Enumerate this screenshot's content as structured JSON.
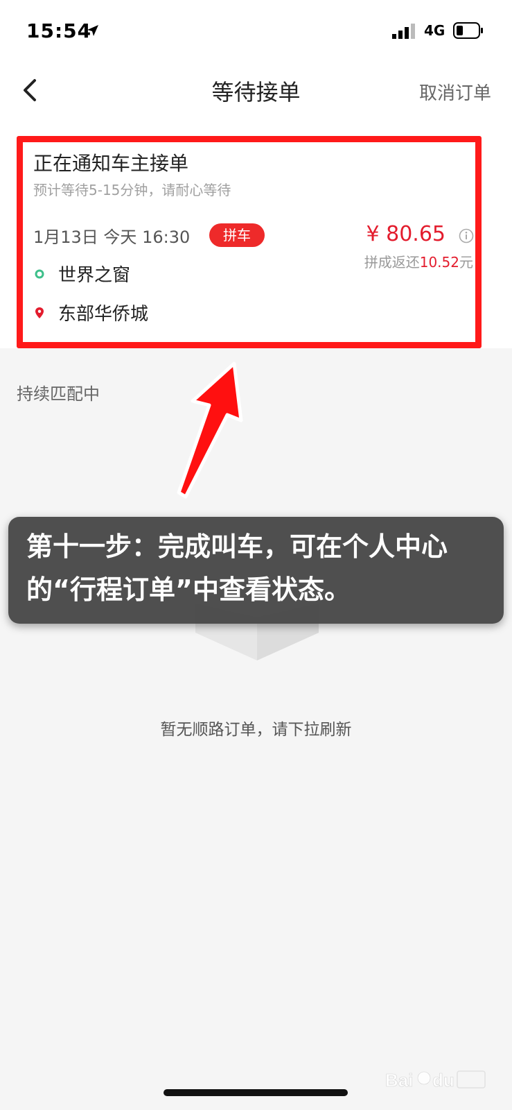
{
  "status_bar": {
    "time": "15:54",
    "network": "4G"
  },
  "nav": {
    "title": "等待接单",
    "cancel_label": "取消订单",
    "back_icon": "chevron-left-icon"
  },
  "order": {
    "status_title": "正在通知车主接单",
    "wait_hint": "预计等待5-15分钟，请耐心等待",
    "trip_time": "1月13日 今天 16:30",
    "carpool_badge": "拼车",
    "price": "¥ 80.65",
    "refund_prefix": "拼成返还",
    "refund_amount": "10.52",
    "refund_suffix": "元",
    "origin": "世界之窗",
    "destination": "东部华侨城"
  },
  "matching_status": "持续匹配中",
  "empty_state": {
    "message": "暂无顺路订单，请下拉刷新"
  },
  "tutorial": {
    "caption": "第十一步：完成叫车，可在个人中心的“行程订单”中查看状态。"
  },
  "colors": {
    "accent_red": "#e31c2d",
    "highlight_red": "#ff1a1a",
    "origin_green": "#3dbf8a",
    "background": "#f5f5f5"
  }
}
